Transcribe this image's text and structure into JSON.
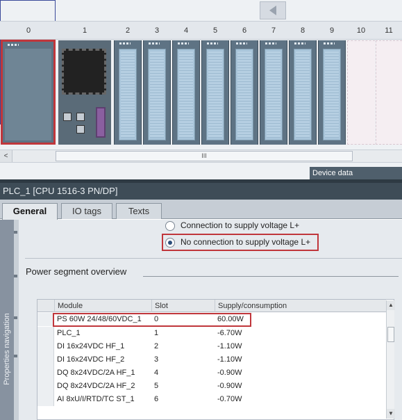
{
  "rack": {
    "slots": [
      "0",
      "1",
      "2",
      "3",
      "4",
      "5",
      "6",
      "7",
      "8",
      "9",
      "10",
      "11"
    ],
    "scroll_thumb_grip": "III",
    "scroll_left_arrow": "<",
    "device_data_tab": "Device data"
  },
  "properties": {
    "title": "PLC_1 [CPU 1516-3 PN/DP]",
    "tabs": [
      {
        "label": "General",
        "active": true
      },
      {
        "label": "IO tags",
        "active": false
      },
      {
        "label": "Texts",
        "active": false
      }
    ],
    "nav_label": "Properties navigation",
    "radio_options": [
      {
        "label": "Connection to supply voltage L+",
        "checked": false
      },
      {
        "label": "No connection to supply voltage L+",
        "checked": true
      }
    ],
    "section_title": "Power segment overview",
    "table": {
      "headers": [
        "Module",
        "Slot",
        "Supply/consumption"
      ],
      "rows": [
        {
          "module": "PS 60W 24/48/60VDC_1",
          "slot": "0",
          "supply": "60.00W"
        },
        {
          "module": "PLC_1",
          "slot": "1",
          "supply": "-6.70W"
        },
        {
          "module": "DI 16x24VDC HF_1",
          "slot": "2",
          "supply": "-1.10W"
        },
        {
          "module": "DI 16x24VDC HF_2",
          "slot": "3",
          "supply": "-1.10W"
        },
        {
          "module": "DQ 8x24VDC/2A HF_1",
          "slot": "4",
          "supply": "-0.90W"
        },
        {
          "module": "DQ 8x24VDC/2A HF_2",
          "slot": "5",
          "supply": "-0.90W"
        },
        {
          "module": "AI 8xU/I/RTD/TC ST_1",
          "slot": "6",
          "supply": "-0.70W"
        }
      ]
    },
    "scroll_up": "▲",
    "scroll_down": "▼"
  },
  "colors": {
    "highlight": "#c0363b",
    "title_bar": "#3e4c57",
    "module_face": "#a9c5da"
  }
}
